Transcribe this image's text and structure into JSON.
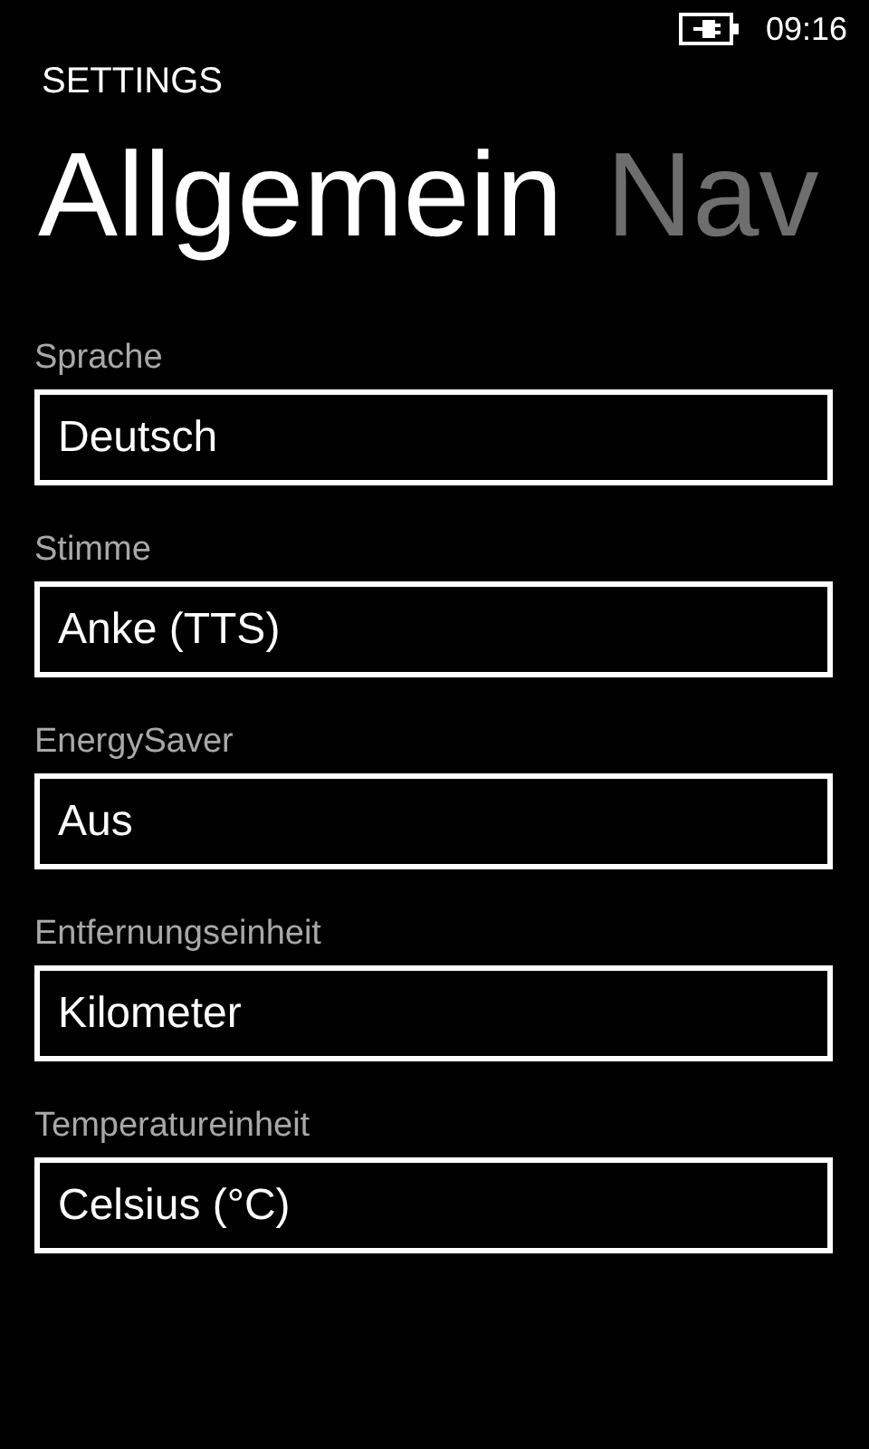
{
  "status_bar": {
    "time": "09:16"
  },
  "app_title": "SETTINGS",
  "pivot": [
    {
      "label": "Allgemein",
      "selected": true
    },
    {
      "label": "Nav",
      "selected": false
    }
  ],
  "settings": [
    {
      "label": "Sprache",
      "value": "Deutsch"
    },
    {
      "label": "Stimme",
      "value": "Anke (TTS)"
    },
    {
      "label": "EnergySaver",
      "value": "Aus"
    },
    {
      "label": "Entfernungseinheit",
      "value": "Kilometer"
    },
    {
      "label": "Temperatureinheit",
      "value": "Celsius (°C)"
    }
  ]
}
